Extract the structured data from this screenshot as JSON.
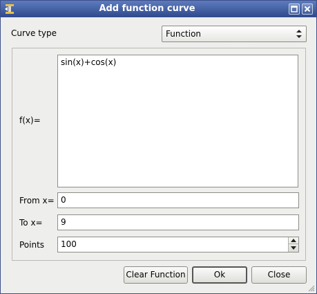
{
  "window": {
    "title": "Add function curve"
  },
  "icons": {
    "app": "app-logo-icon",
    "maximize": "maximize-icon",
    "close": "close-icon",
    "combo_arrows": "updown-arrows-icon",
    "spin_up": "chevron-up-icon",
    "spin_down": "chevron-down-icon",
    "grip": "resize-grip-icon"
  },
  "colors": {
    "titlebar": "#2f4a8c",
    "dialog_bg": "#eeeeec"
  },
  "curve_type": {
    "label": "Curve type",
    "selected": "Function"
  },
  "function": {
    "label": "f(x)=",
    "value": "sin(x)+cos(x)"
  },
  "from": {
    "label": "From x=",
    "value": "0"
  },
  "to": {
    "label": "To x=",
    "value": "9"
  },
  "points": {
    "label": "Points",
    "value": "100"
  },
  "buttons": {
    "clear": "Clear Function",
    "ok": "Ok",
    "close": "Close"
  }
}
